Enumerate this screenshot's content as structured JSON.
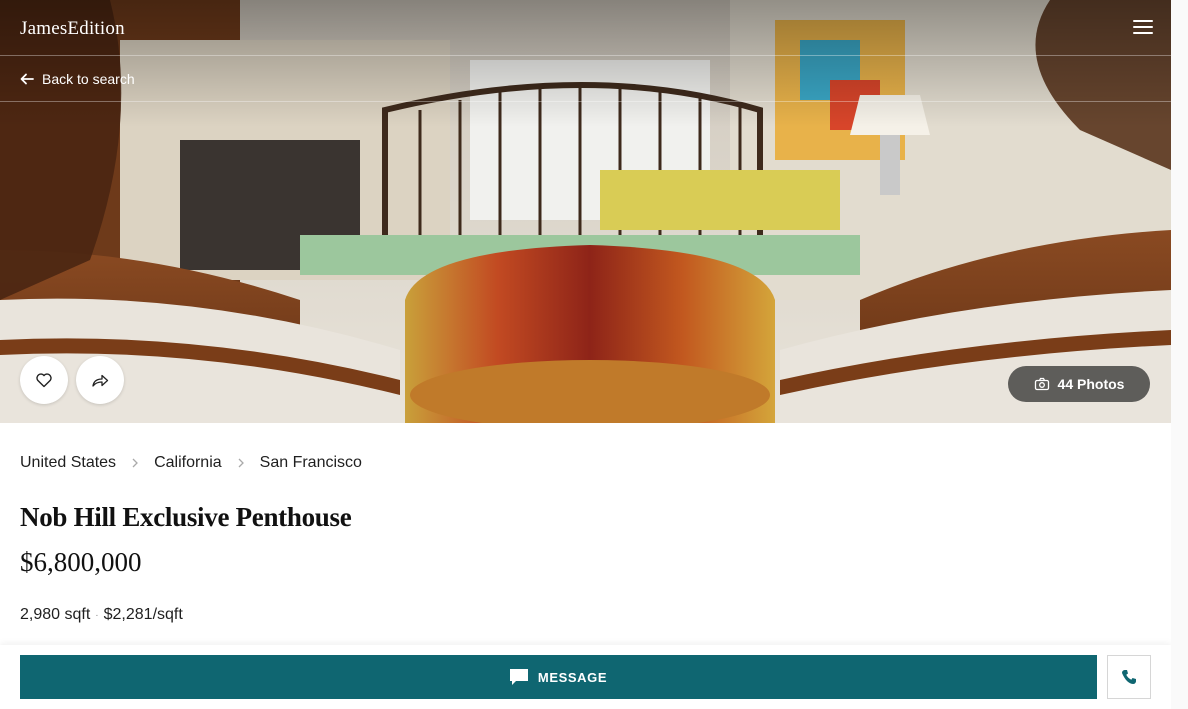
{
  "header": {
    "logo_text": "JamesEdition",
    "menu_icon": "hamburger-menu-icon"
  },
  "nav": {
    "back_label": "Back to search"
  },
  "gallery": {
    "photos_label": "44 Photos",
    "favorite_icon": "heart-icon",
    "share_icon": "share-arrow-icon",
    "camera_icon": "camera-icon"
  },
  "breadcrumb": {
    "items": [
      "United States",
      "California",
      "San Francisco"
    ]
  },
  "listing": {
    "title": "Nob Hill Exclusive Penthouse",
    "price": "$6,800,000",
    "area": "2,980 sqft",
    "separator": "·",
    "price_per_area": "$2,281/sqft"
  },
  "actions": {
    "message_label": "MESSAGE",
    "message_icon": "chat-bubble-icon",
    "call_icon": "phone-icon"
  },
  "colors": {
    "accent": "#0f6671",
    "text": "#1a1a1a"
  }
}
